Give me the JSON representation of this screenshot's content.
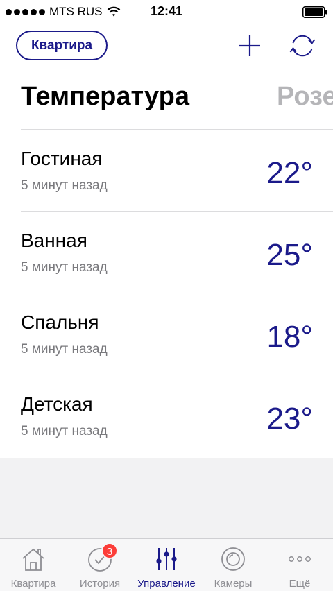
{
  "status_bar": {
    "carrier": "MTS RUS",
    "time": "12:41",
    "signal_icon": "signal-dots-icon",
    "wifi_icon": "wifi-icon",
    "battery_icon": "battery-icon"
  },
  "header": {
    "home_button_label": "Квартира",
    "add_icon": "plus-icon",
    "sync_icon": "sync-icon"
  },
  "category_tabs": {
    "active": "Температура",
    "next": "Розе"
  },
  "rooms": [
    {
      "name": "Гостиная",
      "updated": "5 минут назад",
      "temperature": "22°"
    },
    {
      "name": "Ванная",
      "updated": "5 минут назад",
      "temperature": "25°"
    },
    {
      "name": "Спальня",
      "updated": "5 минут назад",
      "temperature": "18°"
    },
    {
      "name": "Детская",
      "updated": "5 минут назад",
      "temperature": "23°"
    }
  ],
  "tabbar": {
    "items": [
      {
        "label": "Квартира",
        "icon": "house-icon"
      },
      {
        "label": "История",
        "icon": "clock-icon",
        "badge": "3"
      },
      {
        "label": "Управление",
        "icon": "sliders-icon"
      },
      {
        "label": "Камеры",
        "icon": "camera-icon"
      },
      {
        "label": "Ещё",
        "icon": "more-icon"
      }
    ],
    "active_index": 2
  },
  "colors": {
    "accent": "#1b1a8a",
    "inactive": "#8e8e93",
    "badge": "#fc3d39"
  }
}
